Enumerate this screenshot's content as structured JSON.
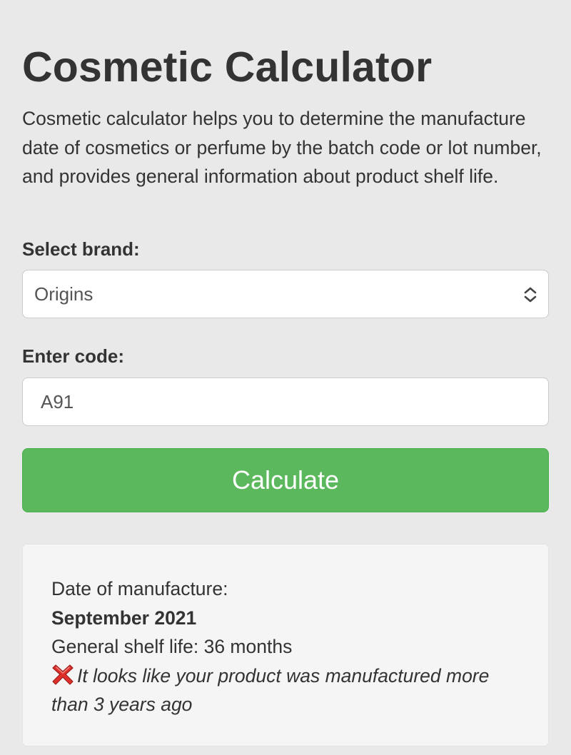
{
  "page": {
    "title": "Cosmetic Calculator",
    "intro": "Cosmetic calculator helps you to determine the manufacture date of cosmetics or perfume by the batch code or lot number, and provides general information about product shelf life."
  },
  "form": {
    "brand_label": "Select brand:",
    "brand_value": "Origins",
    "code_label": "Enter code:",
    "code_value": "A91",
    "submit_label": "Calculate"
  },
  "result": {
    "date_label": "Date of manufacture:",
    "date_value": "September 2021",
    "shelf_life": "General shelf life: 36 months",
    "warning": "It looks like your product was manufactured more than 3 years ago",
    "warning_icon": "red-cross-icon"
  },
  "colors": {
    "background": "#e9e9e9",
    "button": "#5cb85c",
    "cross": "#e0302b"
  }
}
